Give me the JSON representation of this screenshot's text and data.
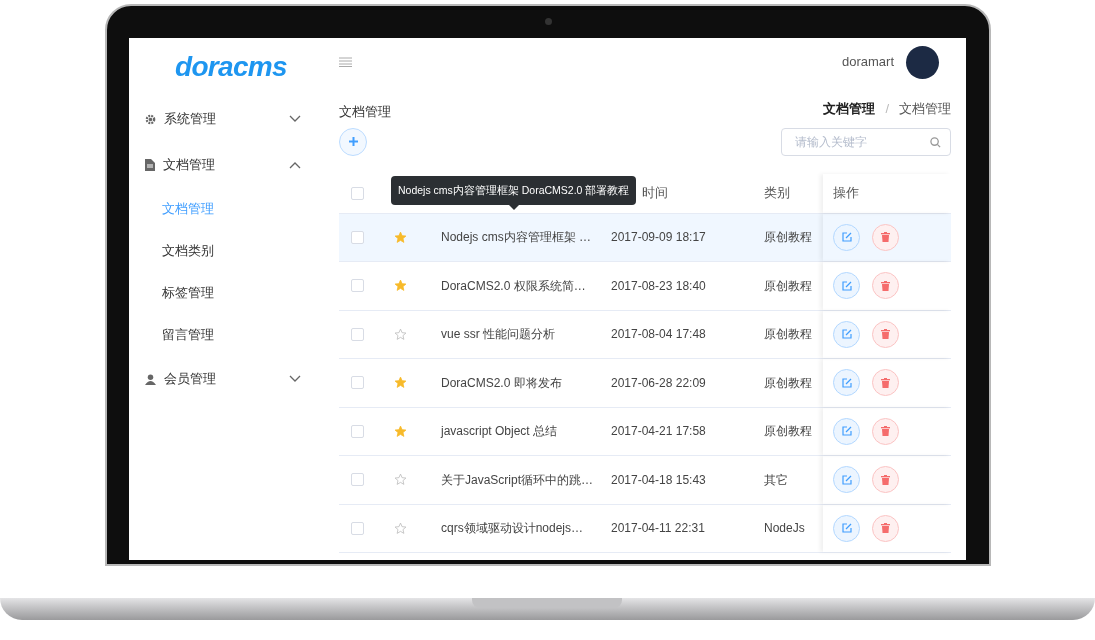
{
  "logo": "doracms",
  "user": {
    "name": "doramart"
  },
  "sidebar": {
    "items": [
      {
        "label": "系统管理",
        "kind": "gear",
        "expanded": false
      },
      {
        "label": "文档管理",
        "kind": "doc",
        "expanded": true,
        "children": [
          {
            "label": "文档管理",
            "selected": true
          },
          {
            "label": "文档类别",
            "selected": false
          },
          {
            "label": "标签管理",
            "selected": false
          },
          {
            "label": "留言管理",
            "selected": false
          }
        ]
      },
      {
        "label": "会员管理",
        "kind": "user",
        "expanded": false
      }
    ]
  },
  "page_title": "文档管理",
  "breadcrumb": [
    "文档管理",
    "文档管理"
  ],
  "breadcrumb_separator": "/",
  "search": {
    "placeholder": "请输入关键字"
  },
  "tooltip": "Nodejs cms内容管理框架 DoraCMS2.0 部署教程",
  "table": {
    "columns": [
      "时间",
      "类别",
      "操作"
    ],
    "header_checked": false,
    "rows": [
      {
        "title": "Nodejs cms内容管理框架 …",
        "time": "2017-09-09 18:17",
        "category": "原创教程",
        "starred": true,
        "hovered": true,
        "checked": false
      },
      {
        "title": "DoraCMS2.0 权限系统简…",
        "time": "2017-08-23 18:40",
        "category": "原创教程",
        "starred": true,
        "hovered": false,
        "checked": false
      },
      {
        "title": "vue ssr 性能问题分析",
        "time": "2017-08-04 17:48",
        "category": "原创教程",
        "starred": false,
        "hovered": false,
        "checked": false
      },
      {
        "title": "DoraCMS2.0 即将发布",
        "time": "2017-06-28 22:09",
        "category": "原创教程",
        "starred": true,
        "hovered": false,
        "checked": false
      },
      {
        "title": "javascript Object 总结",
        "time": "2017-04-21 17:58",
        "category": "原创教程",
        "starred": true,
        "hovered": false,
        "checked": false
      },
      {
        "title": "关于JavaScript循环中的跳…",
        "time": "2017-04-18 15:43",
        "category": "其它",
        "starred": false,
        "hovered": false,
        "checked": false
      },
      {
        "title": "cqrs领域驱动设计nodejs…",
        "time": "2017-04-11 22:31",
        "category": "NodeJs",
        "starred": false,
        "hovered": false,
        "checked": false
      }
    ]
  }
}
